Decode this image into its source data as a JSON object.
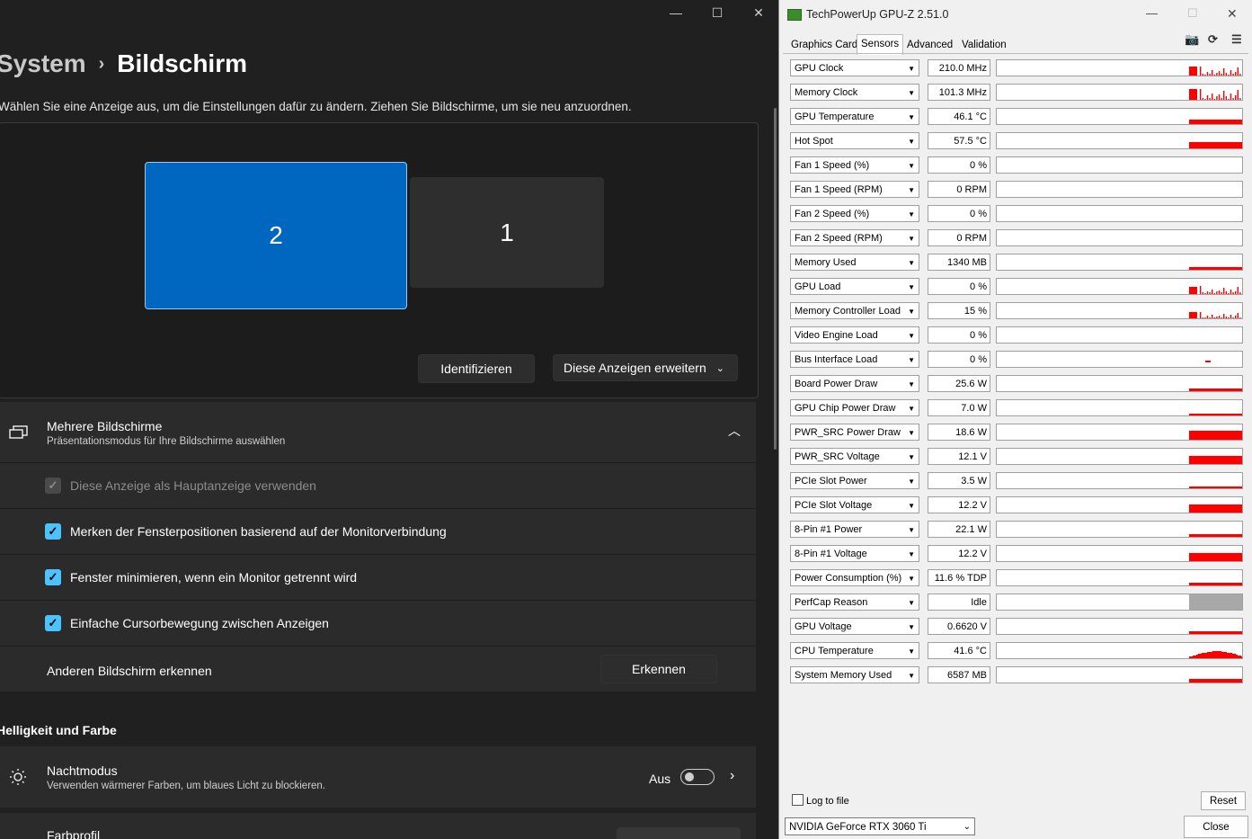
{
  "settings": {
    "window_controls": {
      "minimize": "—",
      "maximize": "☐",
      "close": "✕"
    },
    "breadcrumb": {
      "parent": "System",
      "separator": "›",
      "current": "Bildschirm"
    },
    "intro": "Wählen Sie eine Anzeige aus, um die Einstellungen dafür zu ändern. Ziehen Sie Bildschirme, um sie neu anzuordnen.",
    "displays": [
      {
        "label": "2",
        "selected": true
      },
      {
        "label": "1",
        "selected": false
      }
    ],
    "identify_button": "Identifizieren",
    "extend_dropdown": "Diese Anzeigen erweitern",
    "multi_display": {
      "title": "Mehrere Bildschirme",
      "subtitle": "Präsentationsmodus für Ihre Bildschirme auswählen",
      "icon": "multi-monitor-icon"
    },
    "options": [
      {
        "label": "Diese Anzeige als Hauptanzeige verwenden",
        "checked": true,
        "disabled": true
      },
      {
        "label": "Merken der Fensterpositionen basierend auf der Monitorverbindung",
        "checked": true,
        "disabled": false
      },
      {
        "label": "Fenster minimieren, wenn ein Monitor getrennt wird",
        "checked": true,
        "disabled": false
      },
      {
        "label": "Einfache Cursorbewegung zwischen Anzeigen",
        "checked": true,
        "disabled": false
      }
    ],
    "detect": {
      "label": "Anderen Bildschirm erkennen",
      "button": "Erkennen"
    },
    "section_brightness": "Helligkeit und Farbe",
    "night_mode": {
      "title": "Nachtmodus",
      "subtitle": "Verwenden wärmerer Farben, um blaues Licht zu blockieren.",
      "state": "Aus",
      "on": false
    },
    "color_profile": {
      "title": "Farbprofil"
    },
    "colors": {
      "accent": "#0067c0",
      "checkbox": "#4cc2ff"
    }
  },
  "gpuz": {
    "title": "TechPowerUp GPU-Z 2.51.0",
    "tabs": [
      "Graphics Card",
      "Sensors",
      "Advanced",
      "Validation"
    ],
    "active_tab": "Sensors",
    "sensors": [
      {
        "name": "GPU Clock",
        "value": "210.0 MHz",
        "graph": "spiky",
        "level": 0.6
      },
      {
        "name": "Memory Clock",
        "value": "101.3 MHz",
        "graph": "spiky",
        "level": 0.7
      },
      {
        "name": "GPU Temperature",
        "value": "46.1 °C",
        "graph": "flat",
        "level": 0.3
      },
      {
        "name": "Hot Spot",
        "value": "57.5 °C",
        "graph": "flat",
        "level": 0.4
      },
      {
        "name": "Fan 1 Speed (%)",
        "value": "0 %",
        "graph": "none",
        "level": 0
      },
      {
        "name": "Fan 1 Speed (RPM)",
        "value": "0 RPM",
        "graph": "none",
        "level": 0
      },
      {
        "name": "Fan 2 Speed (%)",
        "value": "0 %",
        "graph": "none",
        "level": 0
      },
      {
        "name": "Fan 2 Speed (RPM)",
        "value": "0 RPM",
        "graph": "none",
        "level": 0
      },
      {
        "name": "Memory Used",
        "value": "1340 MB",
        "graph": "flat",
        "level": 0.15
      },
      {
        "name": "GPU Load",
        "value": "0 %",
        "graph": "spiky",
        "level": 0.5
      },
      {
        "name": "Memory Controller Load",
        "value": "15 %",
        "graph": "spiky",
        "level": 0.4
      },
      {
        "name": "Video Engine Load",
        "value": "0 %",
        "graph": "none",
        "level": 0
      },
      {
        "name": "Bus Interface Load",
        "value": "0 %",
        "graph": "dot",
        "level": 0.1
      },
      {
        "name": "Board Power Draw",
        "value": "25.6 W",
        "graph": "flat",
        "level": 0.15
      },
      {
        "name": "GPU Chip Power Draw",
        "value": "7.0 W",
        "graph": "flat",
        "level": 0.1
      },
      {
        "name": "PWR_SRC Power Draw",
        "value": "18.6 W",
        "graph": "flat",
        "level": 0.6
      },
      {
        "name": "PWR_SRC Voltage",
        "value": "12.1 V",
        "graph": "flat",
        "level": 0.55
      },
      {
        "name": "PCIe Slot Power",
        "value": "3.5 W",
        "graph": "flat",
        "level": 0.1
      },
      {
        "name": "PCIe Slot Voltage",
        "value": "12.2 V",
        "graph": "flat",
        "level": 0.55
      },
      {
        "name": "8-Pin #1 Power",
        "value": "22.1 W",
        "graph": "flat",
        "level": 0.2
      },
      {
        "name": "8-Pin #1 Voltage",
        "value": "12.2 V",
        "graph": "flat",
        "level": 0.55
      },
      {
        "name": "Power Consumption (%)",
        "value": "11.6 % TDP",
        "graph": "flat",
        "level": 0.15
      },
      {
        "name": "PerfCap Reason",
        "value": "Idle",
        "graph": "gray",
        "level": 1
      },
      {
        "name": "GPU Voltage",
        "value": "0.6620 V",
        "graph": "flat",
        "level": 0.2
      },
      {
        "name": "CPU Temperature",
        "value": "41.6 °C",
        "graph": "hump",
        "level": 0.45
      },
      {
        "name": "System Memory Used",
        "value": "6587 MB",
        "graph": "flat",
        "level": 0.25
      }
    ],
    "log_to_file": "Log to file",
    "reset_button": "Reset",
    "close_button": "Close",
    "gpu_select": "NVIDIA GeForce RTX 3060 Ti",
    "colors": {
      "graph": "#ff0000",
      "idle": "#a8a8a8"
    }
  }
}
